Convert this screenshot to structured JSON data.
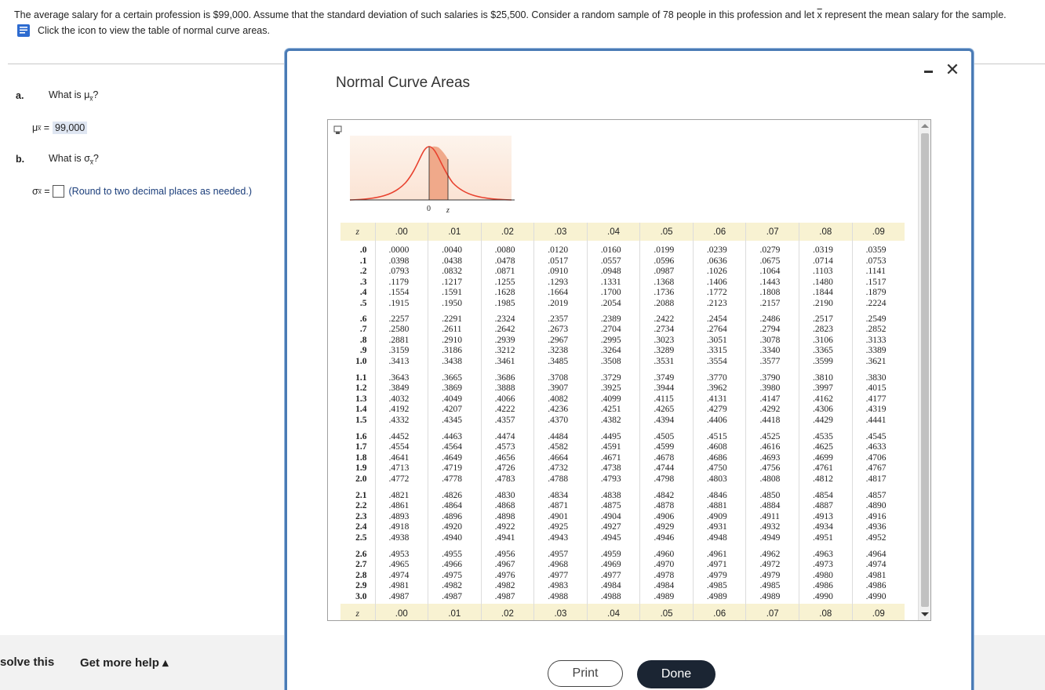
{
  "problem": {
    "text_before": "The average salary for a certain profession is $99,000. Assume that the standard deviation of such salaries is $25,500. Consider a random sample of 78 people in this profession and let ",
    "xbar": "x",
    "text_after": " represent the mean salary for the sample.",
    "hint": "Click the icon to view the table of normal curve areas."
  },
  "questions": {
    "a_label": "a.",
    "a_text_pre": "What is μ",
    "a_text_sub": "x̅",
    "a_text_post": "?",
    "a_answer_sym": "μ",
    "a_answer_sub": "x̅",
    "a_answer_eq": "=",
    "a_answer_value": "99,000",
    "b_label": "b.",
    "b_text_pre": "What is σ",
    "b_text_sub": "x̅",
    "b_text_post": "?",
    "b_answer_sym": "σ",
    "b_answer_sub": "x̅",
    "b_answer_eq": "=",
    "b_answer_note": "(Round to two decimal places as needed.)"
  },
  "footer": {
    "solve": "solve this",
    "help": "Get more help ▴"
  },
  "modal": {
    "title": "Normal Curve Areas",
    "curve_label_zero": "0",
    "curve_label_z": "z",
    "print_label": "Print",
    "done_label": "Done",
    "colors": {
      "border": "#4a7bb5",
      "header_bg": "#f8f2d2",
      "curve": "#e8412e",
      "shade": "#f0a98a",
      "done_bg": "#1b2533"
    }
  },
  "table": {
    "z_header": "z",
    "columns": [
      ".00",
      ".01",
      ".02",
      ".03",
      ".04",
      ".05",
      ".06",
      ".07",
      ".08",
      ".09"
    ],
    "groups": [
      {
        "z": [
          ".0",
          ".1",
          ".2",
          ".3",
          ".4",
          ".5"
        ],
        "cols": [
          [
            ".0000",
            ".0398",
            ".0793",
            ".1179",
            ".1554",
            ".1915"
          ],
          [
            ".0040",
            ".0438",
            ".0832",
            ".1217",
            ".1591",
            ".1950"
          ],
          [
            ".0080",
            ".0478",
            ".0871",
            ".1255",
            ".1628",
            ".1985"
          ],
          [
            ".0120",
            ".0517",
            ".0910",
            ".1293",
            ".1664",
            ".2019"
          ],
          [
            ".0160",
            ".0557",
            ".0948",
            ".1331",
            ".1700",
            ".2054"
          ],
          [
            ".0199",
            ".0596",
            ".0987",
            ".1368",
            ".1736",
            ".2088"
          ],
          [
            ".0239",
            ".0636",
            ".1026",
            ".1406",
            ".1772",
            ".2123"
          ],
          [
            ".0279",
            ".0675",
            ".1064",
            ".1443",
            ".1808",
            ".2157"
          ],
          [
            ".0319",
            ".0714",
            ".1103",
            ".1480",
            ".1844",
            ".2190"
          ],
          [
            ".0359",
            ".0753",
            ".1141",
            ".1517",
            ".1879",
            ".2224"
          ]
        ]
      },
      {
        "z": [
          ".6",
          ".7",
          ".8",
          ".9",
          "1.0"
        ],
        "cols": [
          [
            ".2257",
            ".2580",
            ".2881",
            ".3159",
            ".3413"
          ],
          [
            ".2291",
            ".2611",
            ".2910",
            ".3186",
            ".3438"
          ],
          [
            ".2324",
            ".2642",
            ".2939",
            ".3212",
            ".3461"
          ],
          [
            ".2357",
            ".2673",
            ".2967",
            ".3238",
            ".3485"
          ],
          [
            ".2389",
            ".2704",
            ".2995",
            ".3264",
            ".3508"
          ],
          [
            ".2422",
            ".2734",
            ".3023",
            ".3289",
            ".3531"
          ],
          [
            ".2454",
            ".2764",
            ".3051",
            ".3315",
            ".3554"
          ],
          [
            ".2486",
            ".2794",
            ".3078",
            ".3340",
            ".3577"
          ],
          [
            ".2517",
            ".2823",
            ".3106",
            ".3365",
            ".3599"
          ],
          [
            ".2549",
            ".2852",
            ".3133",
            ".3389",
            ".3621"
          ]
        ]
      },
      {
        "z": [
          "1.1",
          "1.2",
          "1.3",
          "1.4",
          "1.5"
        ],
        "cols": [
          [
            ".3643",
            ".3849",
            ".4032",
            ".4192",
            ".4332"
          ],
          [
            ".3665",
            ".3869",
            ".4049",
            ".4207",
            ".4345"
          ],
          [
            ".3686",
            ".3888",
            ".4066",
            ".4222",
            ".4357"
          ],
          [
            ".3708",
            ".3907",
            ".4082",
            ".4236",
            ".4370"
          ],
          [
            ".3729",
            ".3925",
            ".4099",
            ".4251",
            ".4382"
          ],
          [
            ".3749",
            ".3944",
            ".4115",
            ".4265",
            ".4394"
          ],
          [
            ".3770",
            ".3962",
            ".4131",
            ".4279",
            ".4406"
          ],
          [
            ".3790",
            ".3980",
            ".4147",
            ".4292",
            ".4418"
          ],
          [
            ".3810",
            ".3997",
            ".4162",
            ".4306",
            ".4429"
          ],
          [
            ".3830",
            ".4015",
            ".4177",
            ".4319",
            ".4441"
          ]
        ]
      },
      {
        "z": [
          "1.6",
          "1.7",
          "1.8",
          "1.9",
          "2.0"
        ],
        "cols": [
          [
            ".4452",
            ".4554",
            ".4641",
            ".4713",
            ".4772"
          ],
          [
            ".4463",
            ".4564",
            ".4649",
            ".4719",
            ".4778"
          ],
          [
            ".4474",
            ".4573",
            ".4656",
            ".4726",
            ".4783"
          ],
          [
            ".4484",
            ".4582",
            ".4664",
            ".4732",
            ".4788"
          ],
          [
            ".4495",
            ".4591",
            ".4671",
            ".4738",
            ".4793"
          ],
          [
            ".4505",
            ".4599",
            ".4678",
            ".4744",
            ".4798"
          ],
          [
            ".4515",
            ".4608",
            ".4686",
            ".4750",
            ".4803"
          ],
          [
            ".4525",
            ".4616",
            ".4693",
            ".4756",
            ".4808"
          ],
          [
            ".4535",
            ".4625",
            ".4699",
            ".4761",
            ".4812"
          ],
          [
            ".4545",
            ".4633",
            ".4706",
            ".4767",
            ".4817"
          ]
        ]
      },
      {
        "z": [
          "2.1",
          "2.2",
          "2.3",
          "2.4",
          "2.5"
        ],
        "cols": [
          [
            ".4821",
            ".4861",
            ".4893",
            ".4918",
            ".4938"
          ],
          [
            ".4826",
            ".4864",
            ".4896",
            ".4920",
            ".4940"
          ],
          [
            ".4830",
            ".4868",
            ".4898",
            ".4922",
            ".4941"
          ],
          [
            ".4834",
            ".4871",
            ".4901",
            ".4925",
            ".4943"
          ],
          [
            ".4838",
            ".4875",
            ".4904",
            ".4927",
            ".4945"
          ],
          [
            ".4842",
            ".4878",
            ".4906",
            ".4929",
            ".4946"
          ],
          [
            ".4846",
            ".4881",
            ".4909",
            ".4931",
            ".4948"
          ],
          [
            ".4850",
            ".4884",
            ".4911",
            ".4932",
            ".4949"
          ],
          [
            ".4854",
            ".4887",
            ".4913",
            ".4934",
            ".4951"
          ],
          [
            ".4857",
            ".4890",
            ".4916",
            ".4936",
            ".4952"
          ]
        ]
      },
      {
        "z": [
          "2.6",
          "2.7",
          "2.8",
          "2.9",
          "3.0"
        ],
        "cols": [
          [
            ".4953",
            ".4965",
            ".4974",
            ".4981",
            ".4987"
          ],
          [
            ".4955",
            ".4966",
            ".4975",
            ".4982",
            ".4987"
          ],
          [
            ".4956",
            ".4967",
            ".4976",
            ".4982",
            ".4987"
          ],
          [
            ".4957",
            ".4968",
            ".4977",
            ".4983",
            ".4988"
          ],
          [
            ".4959",
            ".4969",
            ".4977",
            ".4984",
            ".4988"
          ],
          [
            ".4960",
            ".4970",
            ".4978",
            ".4984",
            ".4989"
          ],
          [
            ".4961",
            ".4971",
            ".4979",
            ".4985",
            ".4989"
          ],
          [
            ".4962",
            ".4972",
            ".4979",
            ".4985",
            ".4989"
          ],
          [
            ".4963",
            ".4973",
            ".4980",
            ".4986",
            ".4990"
          ],
          [
            ".4964",
            ".4974",
            ".4981",
            ".4986",
            ".4990"
          ]
        ]
      }
    ]
  }
}
